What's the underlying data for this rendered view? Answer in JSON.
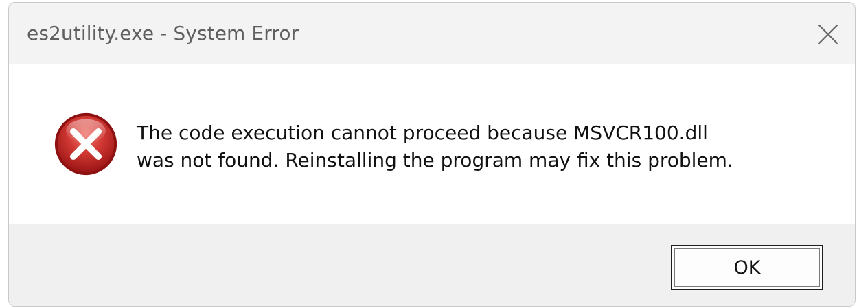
{
  "dialog": {
    "title": "es2utility.exe - System Error",
    "message_lines": [
      "The code execution cannot proceed because MSVCR100.dll",
      "was not found. Reinstalling the program may fix this problem."
    ],
    "ok_label": "OK"
  },
  "icons": {
    "status": "error-icon",
    "close": "close-icon"
  },
  "colors": {
    "error_red": "#c0282b",
    "title_text": "#5f5f5f",
    "footer_bg": "#f0f0f0"
  }
}
